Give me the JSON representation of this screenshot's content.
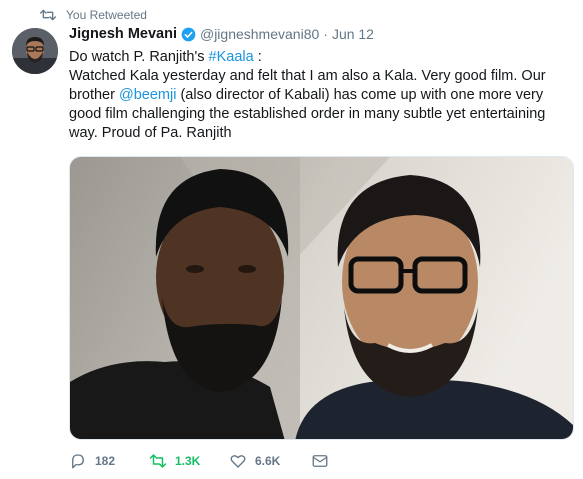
{
  "retweet_banner": {
    "text": "You Retweeted"
  },
  "tweet": {
    "author_name": "Jignesh Mevani",
    "handle": "@jigneshmevani80",
    "separator": "·",
    "date": "Jun 12",
    "line1_prefix": "Do watch P. Ranjith's ",
    "line1_hashtag": "#Kaala",
    "line1_suffix": " :",
    "line2_prefix": "Watched Kala yesterday and felt that I am also a Kala. Very good film. Our brother ",
    "line2_mention": "@beemji",
    "line2_suffix": " (also director of Kabali) has come up with one more very good film challenging the established order in many subtle yet entertaining way. Proud of Pa. Ranjith"
  },
  "actions": {
    "reply_count": "182",
    "retweet_count": "1.3K",
    "like_count": "6.6K"
  },
  "colors": {
    "link": "#1b95e0",
    "retweeted": "#17bf63",
    "muted": "#657786",
    "verified": "#1da1f2"
  },
  "icons": {
    "retweet_banner": "retweet-icon",
    "verified": "verified-badge-icon",
    "reply": "reply-icon",
    "retweet": "retweet-icon",
    "like": "heart-icon",
    "message": "direct-message-icon"
  }
}
